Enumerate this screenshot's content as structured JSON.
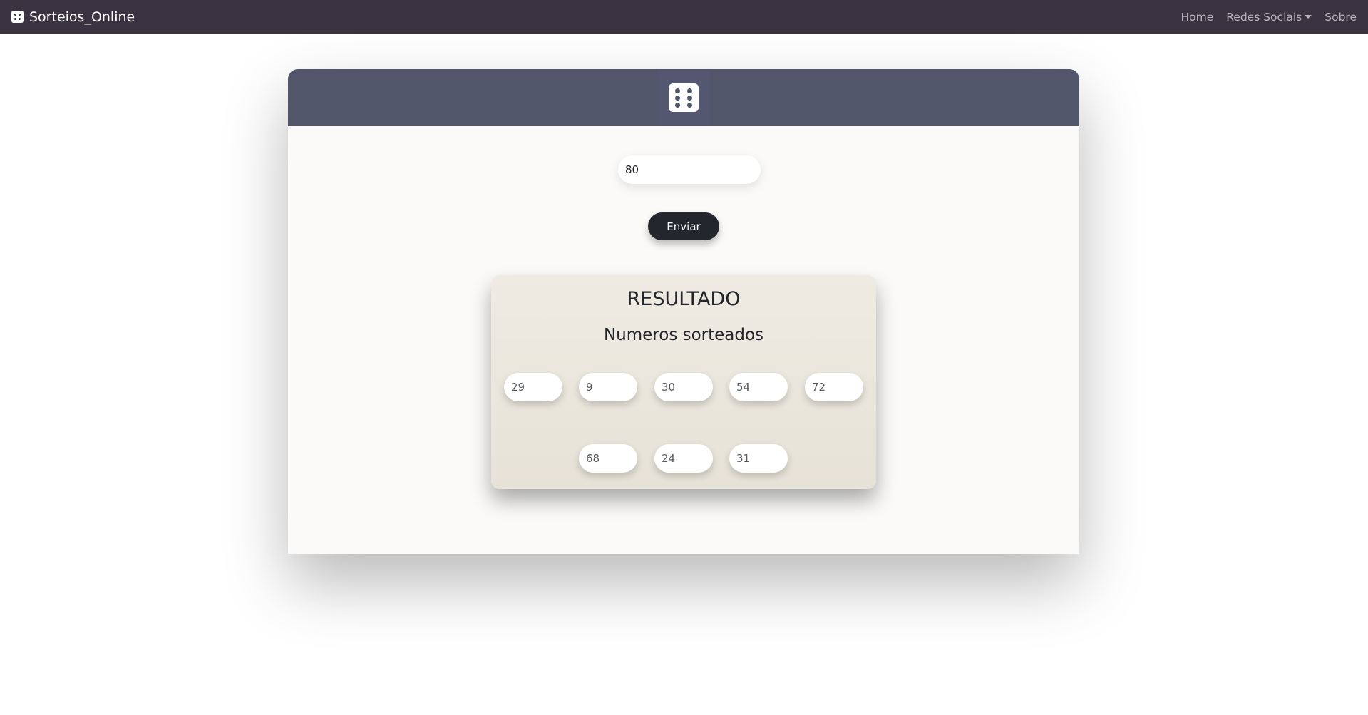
{
  "navbar": {
    "brand": "Sorteios_Online",
    "links": [
      "Home",
      "Redes Sociais",
      "Sobre"
    ]
  },
  "form": {
    "input_value": "80",
    "submit_label": "Enviar"
  },
  "result": {
    "title": "RESULTADO",
    "subtitle": "Numeros sorteados",
    "numbers": [
      "29",
      "9",
      "30",
      "54",
      "72",
      "68",
      "24",
      "31"
    ]
  },
  "colors": {
    "navbar": "#3a3442",
    "card_header": "#51566b",
    "button": "#23272d",
    "result_bg": "#ece8df"
  },
  "icons": {
    "brand": "dice-icon",
    "header": "dice-icon",
    "dropdown": "caret-down-icon"
  }
}
